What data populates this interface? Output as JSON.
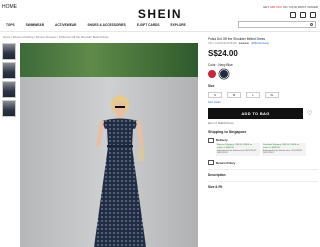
{
  "topbar": {
    "home": "HOME",
    "promo_prefix": "GET",
    "promo_code": "S$5 OFF",
    "promo_suffix": "ON YOUR FIRST ORDER"
  },
  "brand": {
    "logo": "SHEIN"
  },
  "nav": [
    "TOPS",
    "SWIMWEAR",
    "ACTIVEWEAR",
    "SHOES & ACCESSORIES",
    "E-GIFT CARDS",
    "EXPLORE"
  ],
  "breadcrumb": "Home / Women Clothing / Women Dresses / Polka Dot Off the Shoulder Belted Dress",
  "product": {
    "name": "Polka Dot Off the Shoulder Belted Dress",
    "sku": "SKU: sw2001212345728",
    "stars": "★★★★★",
    "reviews": "(1680 Reviews)",
    "price": "S$24.00",
    "color_label": "Color : Navy Blue",
    "size_label": "Size",
    "sizes": [
      "S",
      "M",
      "L",
      "XL"
    ],
    "size_guide": "Size Guide",
    "add_to_bag": "ADD TO BAG",
    "earn": "Earn 17 SHEIN Points"
  },
  "shipping": {
    "title": "Shipping to Singapore",
    "delivery": "Delivery",
    "express": "Express Shipping: S$5.00, FREE on orders ≥ S$49.00",
    "express_est": "Estimated to be delivered on 06/12/2021 - 09/12/2021",
    "standard": "Standard Shipping: S$3.00, FREE on orders ≥ S$39.00",
    "standard_est": "Estimated to be delivered on 12/12/2021 - 18/12/2021",
    "return": "Return Policy"
  },
  "sections": {
    "description": "Description",
    "size_fit": "Size & Fit"
  },
  "colors": {
    "accent": "#111111",
    "swatch_red": "#c8263a",
    "swatch_navy": "#1d2a44",
    "link": "#2b6cd3"
  }
}
